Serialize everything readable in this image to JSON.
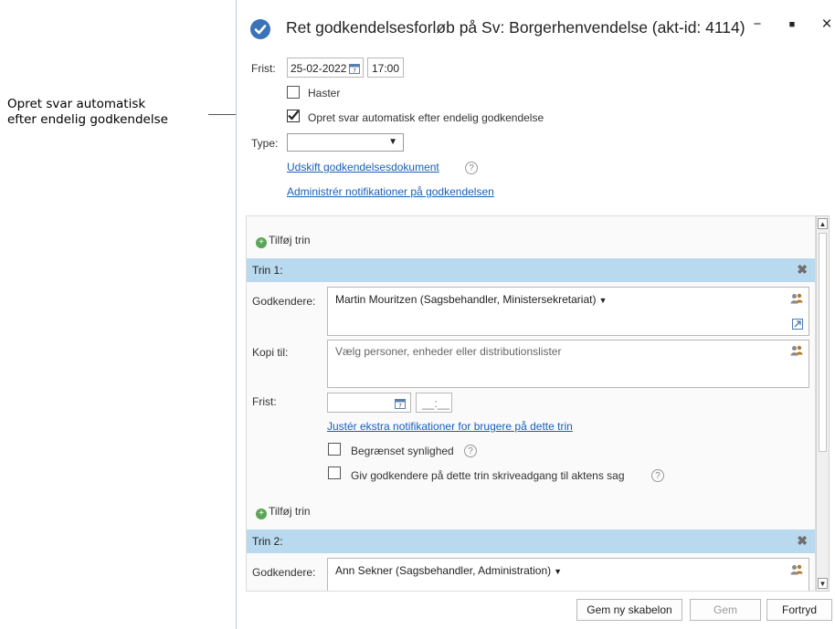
{
  "annotation": {
    "line1": "Opret svar automatisk",
    "line2": "efter endelig godkendelse"
  },
  "window": {
    "title": "Ret godkendelsesforløb på Sv: Borgerhenvendelse (akt-id: 4114)",
    "minimize": "−",
    "maximize": "■",
    "close": "×"
  },
  "form": {
    "deadline_label": "Frist:",
    "deadline_date": "25-02-2022",
    "deadline_time": "17:00",
    "urgent_label": "Haster",
    "urgent_checked": false,
    "auto_reply_label": "Opret svar automatisk efter endelig godkendelse",
    "auto_reply_checked": true,
    "type_label": "Type:",
    "type_value": "",
    "replace_document_link": "Udskift godkendelsesdokument",
    "manage_notifications_link": "Administrér notifikationer på godkendelsen"
  },
  "steps_panel": {
    "add_step": "Tilføj trin",
    "step1": {
      "title": "Trin 1:",
      "approvers_label": "Godkendere:",
      "approvers_value": "Martin Mouritzen (Sagsbehandler, Ministersekretariat)",
      "copy_label": "Kopi til:",
      "copy_placeholder": "Vælg personer, enheder eller distributionslister",
      "deadline_label": "Frist:",
      "deadline_date": "",
      "deadline_time": "__:__",
      "notifications_link": "Justér ekstra notifikationer for brugere på dette trin",
      "restricted_label": "Begrænset synlighed",
      "write_access_label": "Giv godkendere på dette trin skriveadgang til aktens sag"
    },
    "step2": {
      "title": "Trin 2:",
      "approvers_label": "Godkendere:",
      "approvers_value": "Ann Sekner (Sagsbehandler, Administration)"
    }
  },
  "buttons": {
    "save_template": "Gem ny skabelon",
    "save": "Gem",
    "cancel": "Fortryd"
  },
  "icons": {
    "title": "check-circle-icon",
    "calendar": "calendar-icon",
    "people": "people-icon",
    "help": "help-icon",
    "remove": "remove-icon",
    "add": "add-icon",
    "expand": "expand-icon"
  },
  "colors": {
    "accent": "#3b73b9",
    "step_header": "#b9d9ee",
    "link": "#1a5fb4"
  }
}
